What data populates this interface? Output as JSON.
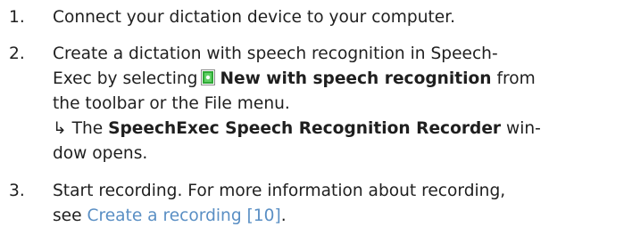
{
  "steps": [
    {
      "number": "1.",
      "text": "Connect your dictation device to your computer."
    },
    {
      "number": "2.",
      "line1": "Create a dictation with speech recognition in Speech-",
      "line2_before": "Exec by selecting",
      "line2_bold": "New with speech recognition",
      "line2_after": " from",
      "line3": "the toolbar or the File menu.",
      "result_arrow": "↳",
      "result_before": "The ",
      "result_bold": "SpeechExec Speech Recognition Recorder",
      "result_after": " win-",
      "result_line2": "dow opens.",
      "icon": "speech-recognition-icon"
    },
    {
      "number": "3.",
      "line1": "Start recording. For more information about recording,",
      "line2_before": "see ",
      "link_text": "Create a recording [10]",
      "line2_after": "."
    }
  ],
  "colors": {
    "text": "#1f1f1f",
    "link": "#5a8fc4",
    "icon_green": "#2fa836"
  }
}
